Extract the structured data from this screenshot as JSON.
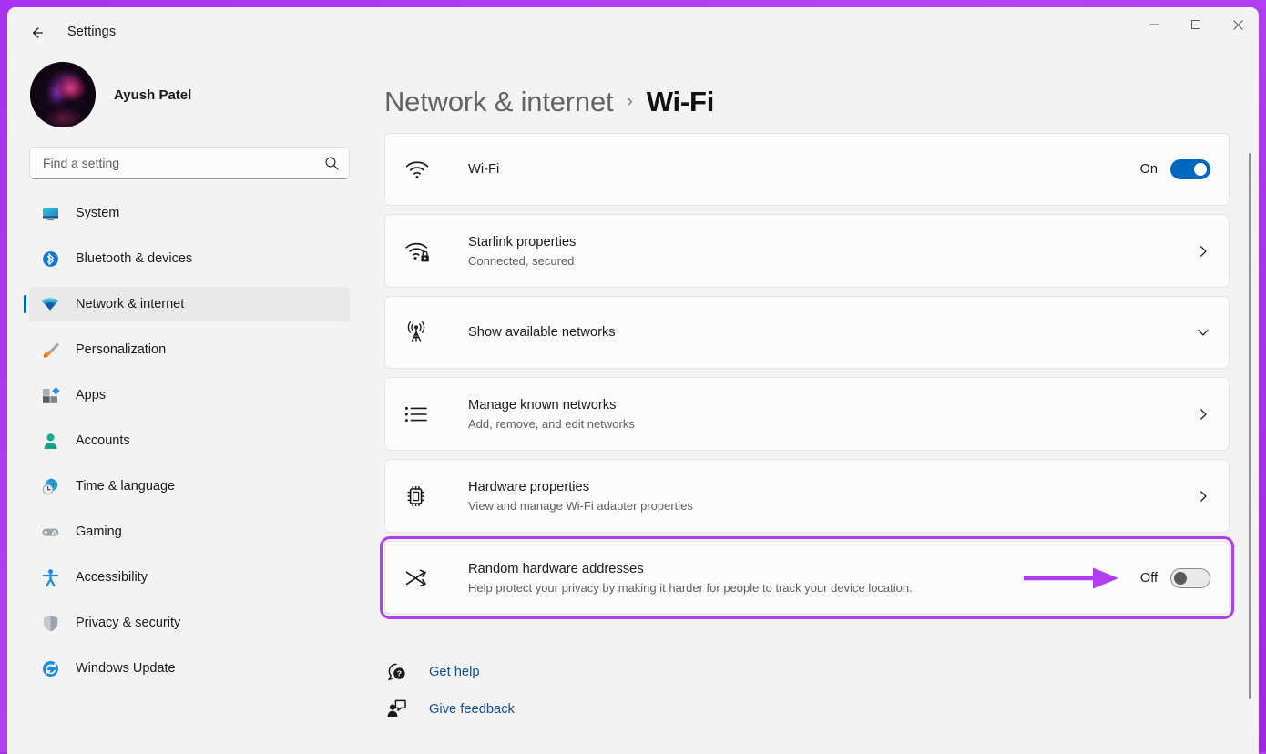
{
  "window": {
    "title": "Settings",
    "back_icon": "arrow-left-icon",
    "controls": [
      {
        "name": "minimize-button",
        "glyph": "minimize-icon"
      },
      {
        "name": "maximize-button",
        "glyph": "maximize-icon"
      },
      {
        "name": "close-button",
        "glyph": "close-icon"
      }
    ]
  },
  "sidebar": {
    "profile": {
      "name": "Ayush Patel",
      "avatar": "user-avatar"
    },
    "search": {
      "placeholder": "Find a setting",
      "value": "",
      "icon": "search-icon"
    },
    "items": [
      {
        "label": "System",
        "icon": "monitor-icon",
        "selected": false
      },
      {
        "label": "Bluetooth & devices",
        "icon": "bluetooth-icon",
        "selected": false
      },
      {
        "label": "Network & internet",
        "icon": "wifi-icon",
        "selected": true
      },
      {
        "label": "Personalization",
        "icon": "paintbrush-icon",
        "selected": false
      },
      {
        "label": "Apps",
        "icon": "apps-icon",
        "selected": false
      },
      {
        "label": "Accounts",
        "icon": "person-icon",
        "selected": false
      },
      {
        "label": "Time & language",
        "icon": "clock-globe-icon",
        "selected": false
      },
      {
        "label": "Gaming",
        "icon": "gamepad-icon",
        "selected": false
      },
      {
        "label": "Accessibility",
        "icon": "accessibility-icon",
        "selected": false
      },
      {
        "label": "Privacy & security",
        "icon": "shield-icon",
        "selected": false
      },
      {
        "label": "Windows Update",
        "icon": "update-icon",
        "selected": false
      }
    ]
  },
  "breadcrumb": {
    "parent": "Network & internet",
    "separator": "›",
    "current": "Wi-Fi"
  },
  "cards": [
    {
      "name": "wifi-toggle-row",
      "icon": "wifi-icon",
      "title": "Wi-Fi",
      "subtitle": "",
      "state_label": "On",
      "control": "toggle-on"
    },
    {
      "name": "starlink-properties-row",
      "icon": "wifi-lock-icon",
      "title": "Starlink properties",
      "subtitle": "Connected, secured",
      "state_label": "",
      "control": "chevron-right"
    },
    {
      "name": "show-available-networks-row",
      "icon": "broadcast-tower-icon",
      "title": "Show available networks",
      "subtitle": "",
      "state_label": "",
      "control": "chevron-down"
    },
    {
      "name": "manage-known-networks-row",
      "icon": "list-icon",
      "title": "Manage known networks",
      "subtitle": "Add, remove, and edit networks",
      "state_label": "",
      "control": "chevron-right"
    },
    {
      "name": "hardware-properties-row",
      "icon": "chip-icon",
      "title": "Hardware properties",
      "subtitle": "View and manage Wi-Fi adapter properties",
      "state_label": "",
      "control": "chevron-right"
    },
    {
      "name": "random-hardware-addresses-row",
      "icon": "shuffle-icon",
      "title": "Random hardware addresses",
      "subtitle": "Help protect your privacy by making it harder for people to track your device location.",
      "state_label": "Off",
      "control": "toggle-off",
      "highlighted": true
    }
  ],
  "links": [
    {
      "label": "Get help",
      "icon": "help-icon"
    },
    {
      "label": "Give feedback",
      "icon": "feedback-icon"
    }
  ],
  "annotation": {
    "color": "#b23cf2",
    "arrow": "right-arrow-annotation",
    "box": "highlight-box-annotation"
  },
  "colors": {
    "accent_blue": "#0067c0",
    "selection_bar": "#005fb8",
    "link_blue": "#0f4f9e",
    "annotation_purple": "#b23cf2",
    "window_bg": "#f3f3f3",
    "card_bg": "#fbfbfb",
    "desktop_purple": "#b03cf0"
  }
}
